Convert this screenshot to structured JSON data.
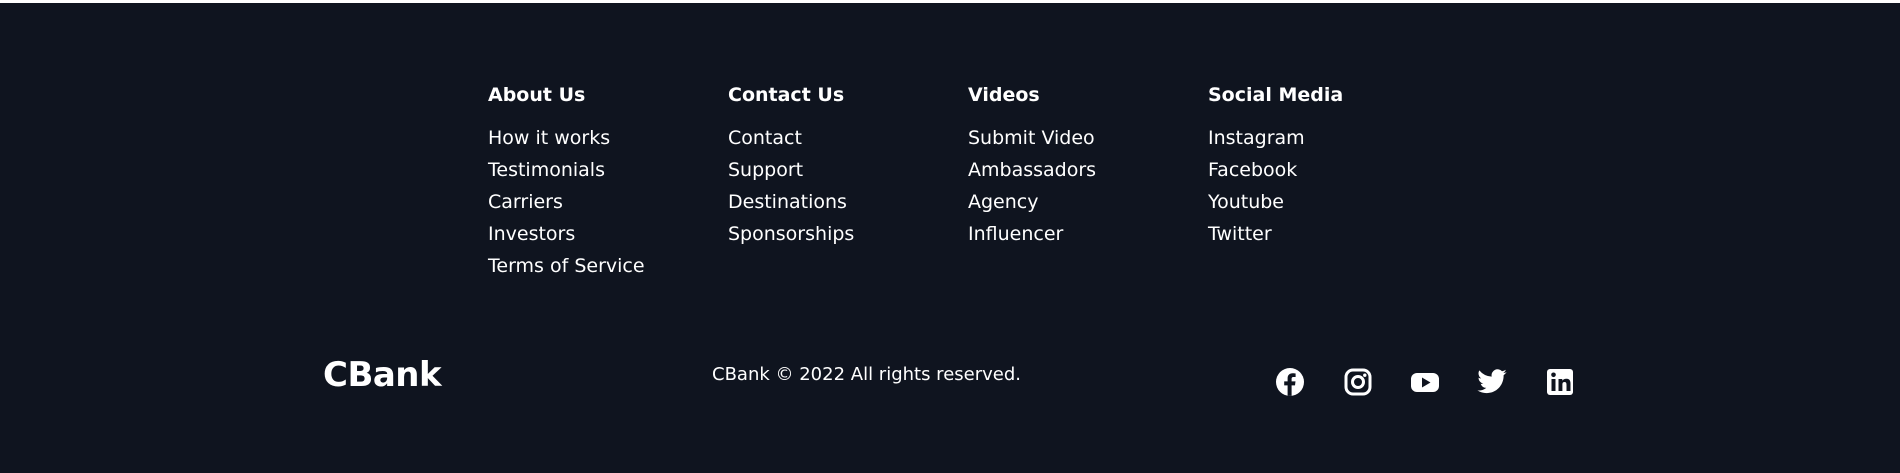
{
  "columns": [
    {
      "heading": "About Us",
      "links": [
        "How it works",
        "Testimonials",
        "Carriers",
        "Investors",
        "Terms of Service"
      ]
    },
    {
      "heading": "Contact Us",
      "links": [
        "Contact",
        "Support",
        "Destinations",
        "Sponsorships"
      ]
    },
    {
      "heading": "Videos",
      "links": [
        "Submit Video",
        "Ambassadors",
        "Agency",
        "Influencer"
      ]
    },
    {
      "heading": "Social Media",
      "links": [
        "Instagram",
        "Facebook",
        "Youtube",
        "Twitter"
      ]
    }
  ],
  "brand": "CBank",
  "copyright": "CBank © 2022 All rights reserved.",
  "social_icons": [
    "facebook-icon",
    "instagram-icon",
    "youtube-icon",
    "twitter-icon",
    "linkedin-icon"
  ],
  "colors": {
    "background": "#0f141f",
    "text": "#ffffff"
  }
}
